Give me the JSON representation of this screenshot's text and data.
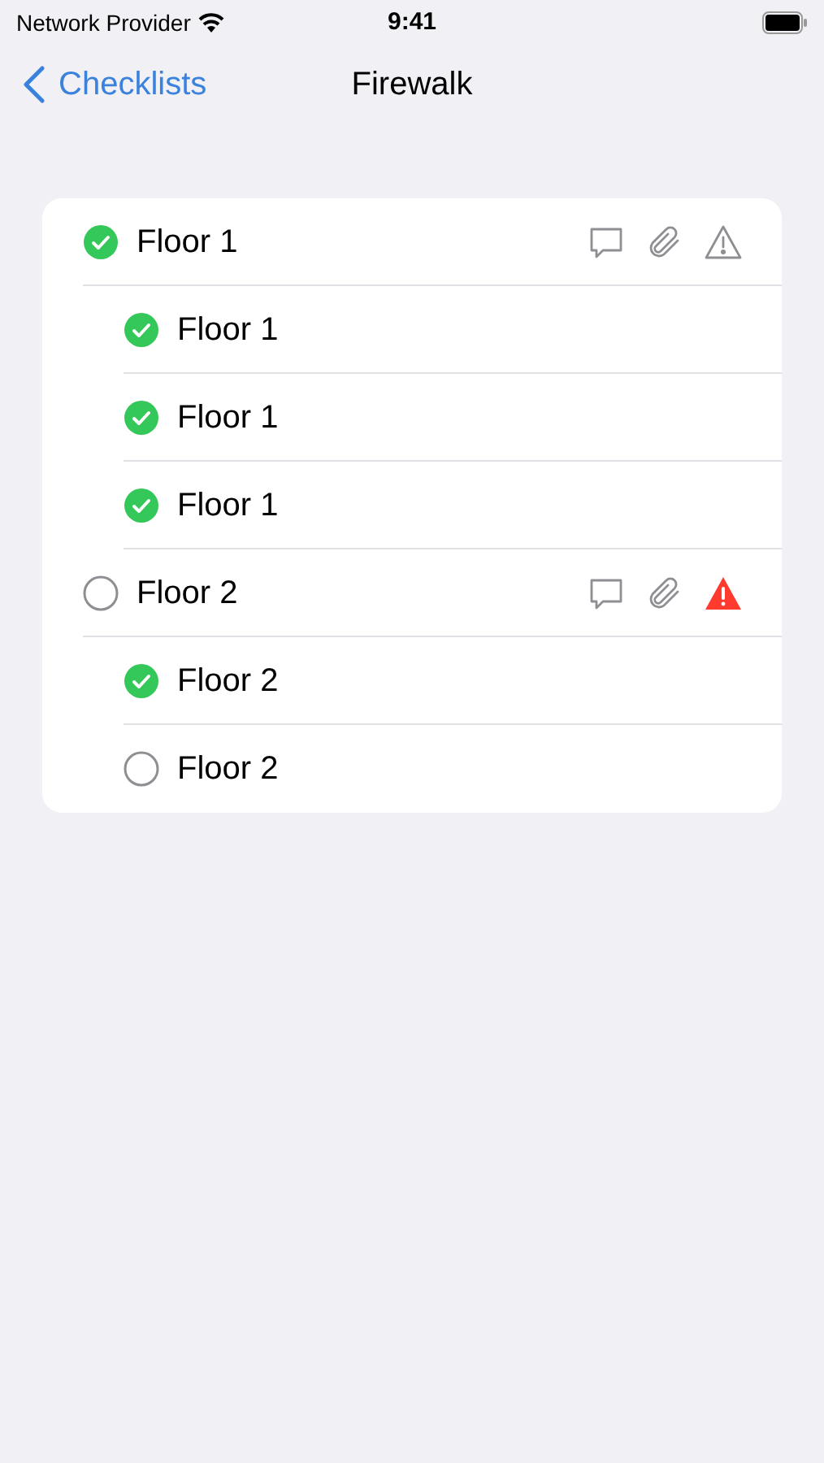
{
  "status_bar": {
    "carrier": "Network Provider",
    "time": "9:41"
  },
  "nav": {
    "back": "Checklists",
    "title": "Firewalk"
  },
  "checklist": [
    {
      "label": "Floor 1",
      "checked": true,
      "alert": false,
      "children": [
        {
          "label": "Floor 1",
          "checked": true
        },
        {
          "label": "Floor 1",
          "checked": true
        },
        {
          "label": "Floor 1",
          "checked": true
        }
      ]
    },
    {
      "label": "Floor 2",
      "checked": false,
      "alert": true,
      "children": [
        {
          "label": "Floor 2",
          "checked": true
        },
        {
          "label": "Floor 2",
          "checked": false
        }
      ]
    }
  ]
}
